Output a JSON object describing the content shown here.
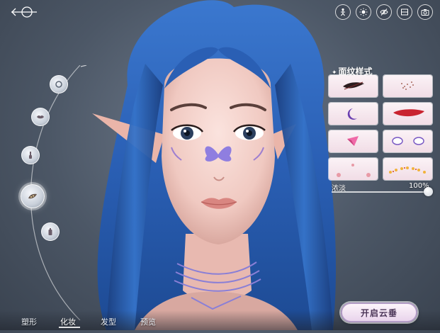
{
  "top_icons": [
    "pose-icon",
    "lighting-icon",
    "eye-icon",
    "compare-icon",
    "camera-icon"
  ],
  "left_menu": {
    "items": [
      {
        "name": "face-shape-icon",
        "active": false
      },
      {
        "name": "lip-icon",
        "active": false
      },
      {
        "name": "brush-icon",
        "active": false
      },
      {
        "name": "face-pattern-icon",
        "active": true
      },
      {
        "name": "bottle-icon",
        "active": false
      }
    ]
  },
  "panel": {
    "title": "面纹样式",
    "patterns": [
      {
        "name": "pattern-feather-ink"
      },
      {
        "name": "pattern-freckles"
      },
      {
        "name": "pattern-moon"
      },
      {
        "name": "pattern-red-stroke"
      },
      {
        "name": "pattern-pink-origami"
      },
      {
        "name": "pattern-eye-marks"
      },
      {
        "name": "pattern-blush-dots"
      },
      {
        "name": "pattern-flower-chain"
      }
    ],
    "slider": {
      "label": "浓淡",
      "value_text": "100%",
      "value": 1.0
    }
  },
  "bottom_tabs": [
    {
      "label": "塑形",
      "active": false
    },
    {
      "label": "化妆",
      "active": true
    },
    {
      "label": "发型",
      "active": false
    },
    {
      "label": "预览",
      "active": false
    }
  ],
  "start_button": "开启云垂",
  "colors": {
    "hair": "#2f63b8",
    "accent": "#b39cc6",
    "panel_cell": "#f6e6ee"
  }
}
